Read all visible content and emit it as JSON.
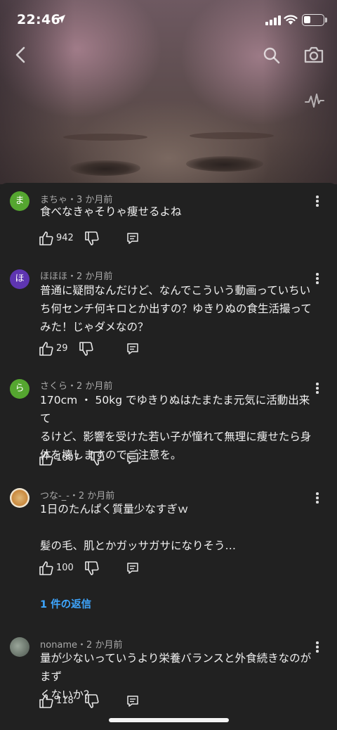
{
  "status_bar": {
    "time": "22:46"
  },
  "comments": [
    {
      "avatar_letter": "ま",
      "avatar_color": "#55a630",
      "meta": "まちゃ・3 か月前",
      "text": "食べなきゃそりゃ痩せるよね",
      "likes": "942"
    },
    {
      "avatar_letter": "ほ",
      "avatar_color": "#5e35b1",
      "meta": "ほほほ・2 か月前",
      "text": "普通に疑問なんだけど、なんでこういう動画っていちい\nち何センチ何キロとか出すの？ゆきりぬの食生活撮って\nみた！じゃダメなの？",
      "likes": "29"
    },
    {
      "avatar_letter": "ら",
      "avatar_color": "#55a630",
      "meta": "さくら・2 か月前",
      "text": "170cm ・ 50kg でゆきりぬはたまたま元気に活動出来て\nるけど、影響を受けた若い子が憧れて無理に痩せたら身\n体を壊しますのでご注意を。",
      "likes": "1007"
    },
    {
      "avatar_letter": "",
      "avatar_color": "#c9a56a",
      "meta": "つな-_-・2 か月前",
      "text": "1日のたんぱく質量少なすぎｗ\n\n髪の毛、肌とかガッサガサになりそう…",
      "likes": "100"
    },
    {
      "avatar_letter": "",
      "avatar_color": "#7d8a7e",
      "meta": "noname・2 か月前",
      "text": "量が少ないっていうより栄養バランスと外食続きなのがまず\nくないか？",
      "likes": "118"
    }
  ],
  "replies_link": "1 件の返信",
  "colors": {
    "accent_link": "#3ea6ff",
    "background": "#212121"
  },
  "icons": [
    "back-arrow-icon",
    "search-icon",
    "camera-icon",
    "activity-icon",
    "like-icon",
    "dislike-icon",
    "reply-icon",
    "more-vertical-icon"
  ]
}
